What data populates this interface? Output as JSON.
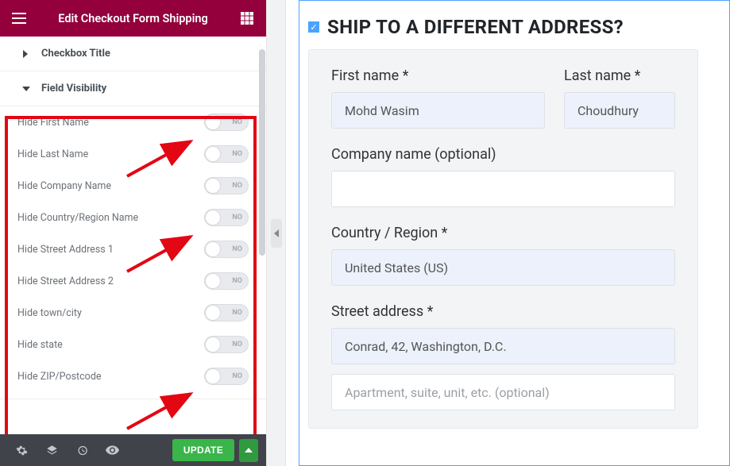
{
  "header": {
    "title": "Edit Checkout Form Shipping"
  },
  "sections": {
    "checkbox_title": "Checkbox Title",
    "field_visibility": "Field Visibility"
  },
  "visibility_items": [
    {
      "label": "Hide First Name",
      "state": "NO"
    },
    {
      "label": "Hide Last Name",
      "state": "NO"
    },
    {
      "label": "Hide Company Name",
      "state": "NO"
    },
    {
      "label": "Hide Country/Region Name",
      "state": "NO"
    },
    {
      "label": "Hide Street Address 1",
      "state": "NO"
    },
    {
      "label": "Hide Street Address 2",
      "state": "NO"
    },
    {
      "label": "Hide town/city",
      "state": "NO"
    },
    {
      "label": "Hide state",
      "state": "NO"
    },
    {
      "label": "Hide ZIP/Postcode",
      "state": "NO"
    }
  ],
  "footer": {
    "update": "UPDATE"
  },
  "preview": {
    "heading": "SHIP TO A DIFFERENT ADDRESS?",
    "first_name_label": "First name *",
    "first_name_value": "Mohd Wasim",
    "last_name_label": "Last name *",
    "last_name_value": "Choudhury",
    "company_label": "Company name (optional)",
    "company_value": "",
    "country_label": "Country / Region *",
    "country_value": "United States (US)",
    "street_label": "Street address *",
    "street1_value": "Conrad, 42, Washington, D.C.",
    "street2_placeholder": "Apartment, suite, unit, etc. (optional)"
  }
}
